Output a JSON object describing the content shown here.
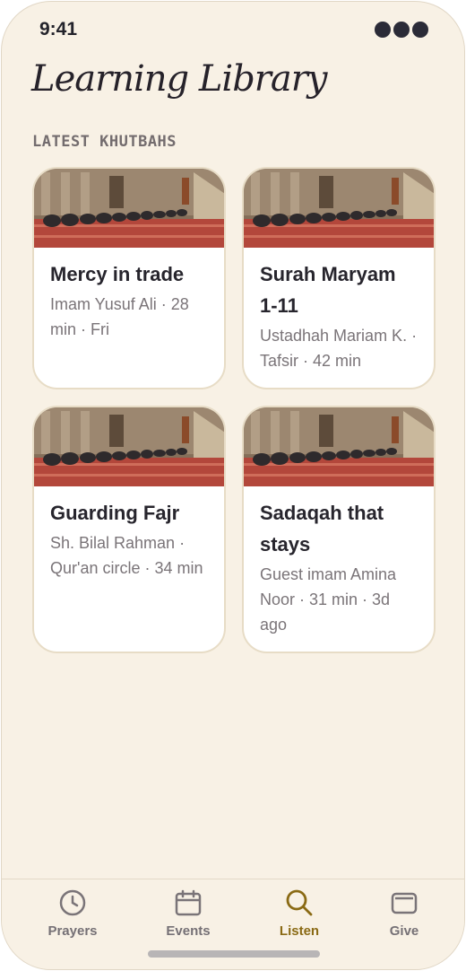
{
  "status_bar": {
    "time": "9:41"
  },
  "header": {
    "title": "Learning Library"
  },
  "section": {
    "label": "LATEST KHUTBAHS"
  },
  "cards": [
    {
      "title": "Mercy in trade",
      "meta": "Imam Yusuf Ali · 28 min · Fri"
    },
    {
      "title": "Surah Maryam 1-11",
      "meta": "Ustadhah Mariam K. · Tafsir · 42 min"
    },
    {
      "title": "Guarding Fajr",
      "meta": "Sh. Bilal Rahman · Qur'an circle · 34 min"
    },
    {
      "title": "Sadaqah that stays",
      "meta": "Guest imam Amina Noor · 31 min · 3d ago"
    }
  ],
  "tabbar": {
    "tabs": [
      {
        "label": "Prayers",
        "icon": "clock-icon"
      },
      {
        "label": "Events",
        "icon": "calendar-icon"
      },
      {
        "label": "Listen",
        "icon": "search-icon",
        "active": true
      },
      {
        "label": "Give",
        "icon": "wallet-icon"
      }
    ]
  },
  "colors": {
    "background": "#f8f1e5",
    "accent": "#8a6a14",
    "card_border": "#e7dcc6"
  }
}
